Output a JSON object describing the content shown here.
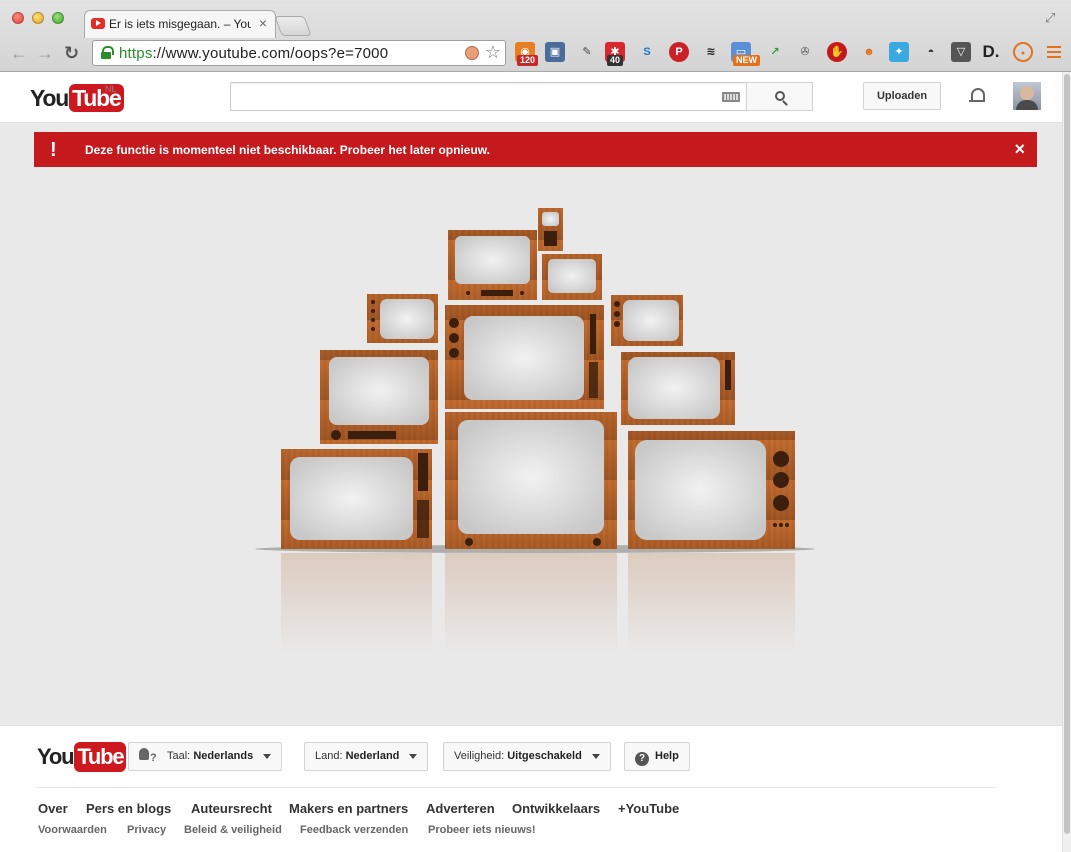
{
  "browser": {
    "tab_title": "Er is iets misgegaan. – You",
    "url_scheme": "https",
    "url_rest": "://www.youtube.com/oops?e=7000",
    "badges": [
      "120",
      "40",
      "NEW"
    ]
  },
  "header": {
    "logo_you": "You",
    "logo_tube": "Tube",
    "country": "NL",
    "search_value": "",
    "upload_label": "Uploaden"
  },
  "alert": {
    "icon": "!",
    "message": "Deze functie is momenteel niet beschikbaar. Probeer het later opnieuw.",
    "close": "×",
    "color": "#c4191d"
  },
  "footer": {
    "logo_you": "You",
    "logo_tube": "Tube",
    "language_prefix": "Taal:",
    "language_value": "Nederlands",
    "country_prefix": "Land:",
    "country_value": "Nederland",
    "safety_prefix": "Veiligheid:",
    "safety_value": "Uitgeschakeld",
    "help_label": "Help",
    "primary_links": [
      "Over",
      "Pers en blogs",
      "Auteursrecht",
      "Makers en partners",
      "Adverteren",
      "Ontwikkelaars",
      "+YouTube"
    ],
    "secondary_links": [
      "Voorwaarden",
      "Privacy",
      "Beleid & veiligheid",
      "Feedback verzenden",
      "Probeer iets nieuws!"
    ]
  },
  "colors": {
    "brand_red": "#cc181e",
    "wood": "#b0602a"
  }
}
